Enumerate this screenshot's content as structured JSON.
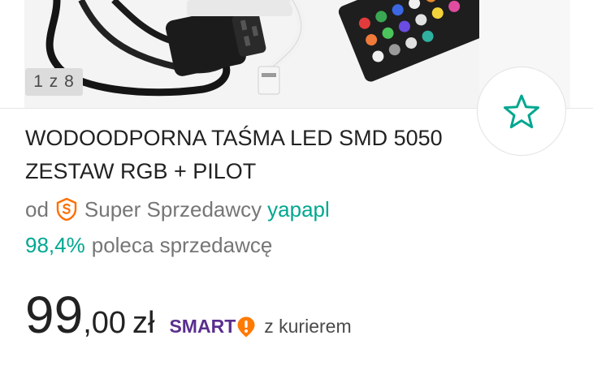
{
  "gallery": {
    "counter": "1 z 8"
  },
  "product": {
    "title": "WODOODPORNA TAŚMA LED SMD 5050 ZESTAW RGB + PILOT"
  },
  "seller": {
    "prefix": "od",
    "badge_icon": "super-seller-badge-icon",
    "status": "Super Sprzedawcy",
    "name": "yapapl"
  },
  "rating": {
    "percent": "98,4%",
    "text": "poleca sprzedawcę"
  },
  "price": {
    "integer": "99",
    "decimal": ",00",
    "currency": "zł"
  },
  "smart": {
    "label": "SMART",
    "delivery": "z kurierem"
  },
  "favorite": {
    "icon": "star-outline-icon"
  },
  "colors": {
    "accent": "#00a790",
    "smart": "#5a2f8f",
    "badge": "#ff6f00"
  }
}
